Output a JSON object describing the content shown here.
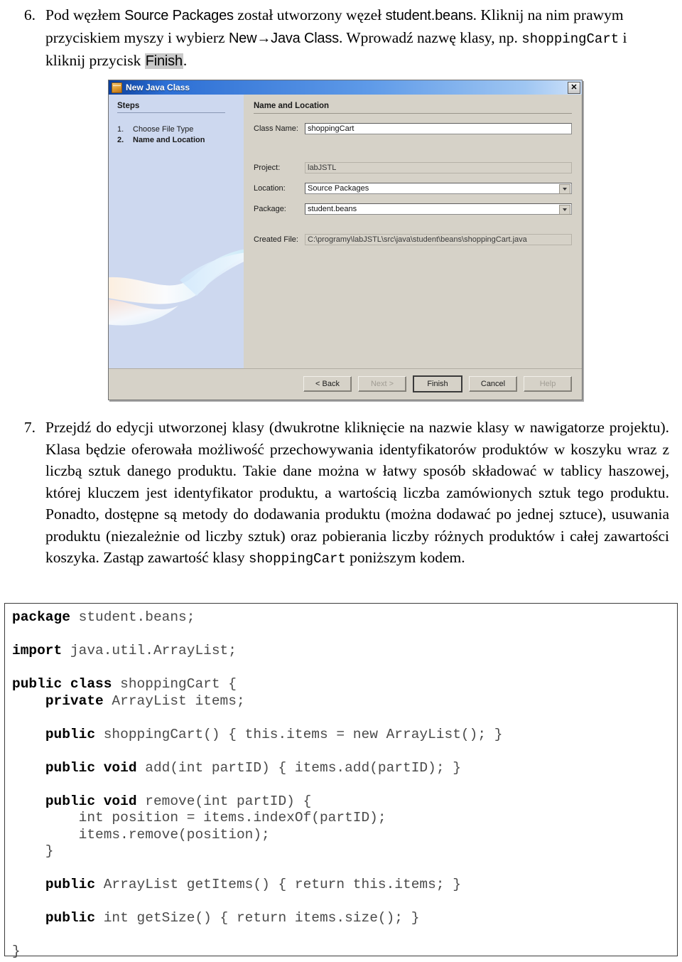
{
  "document": {
    "language": "pl",
    "steps": [
      {
        "number": "6.",
        "segments": [
          {
            "t": "Pod węzłem ",
            "style": "serif"
          },
          {
            "t": "Source Packages",
            "style": "ui-bold"
          },
          {
            "t": " został utworzony węzeł ",
            "style": "serif"
          },
          {
            "t": "student.beans",
            "style": "ui-bold"
          },
          {
            "t": ". Kliknij na nim prawym przyciskiem myszy i wybierz ",
            "style": "serif"
          },
          {
            "t": "New→Java Class",
            "style": "ui-bold"
          },
          {
            "t": ". Wprowadź nazwę klasy, np. ",
            "style": "serif"
          },
          {
            "t": "shoppingCart",
            "style": "mono"
          },
          {
            "t": " i kliknij przycisk ",
            "style": "serif"
          },
          {
            "t": "Finish",
            "style": "ui-highlight"
          },
          {
            "t": ".",
            "style": "serif"
          }
        ],
        "plain": "Pod węzłem Source Packages został utworzony węzeł student.beans. Kliknij na nim prawym przyciskiem myszy i wybierz New→Java Class. Wprowadź nazwę klasy, np. shoppingCart i kliknij przycisk Finish."
      },
      {
        "number": "7.",
        "plain": "Przejdź do edycji utworzonej klasy (dwukrotne kliknięcie na nazwie klasy w nawigatorze projektu). Klasa będzie oferowała możliwość przechowywania identyfikatorów produktów w koszyku wraz z liczbą sztuk danego produktu. Takie dane można w łatwy sposób składować w tablicy haszowej, której kluczem jest identyfikator produktu, a wartością liczba zamówionych sztuk tego produktu. Ponadto, dostępne są metody do dodawania produktu (można dodawać po jednej sztuce), usuwania produktu (niezależnie od liczby sztuk) oraz pobierania liczby różnych produktów i całej zawartości koszyka. Zastąp zawartość klasy shoppingCart poniższym kodem.",
        "parts": {
          "before_code": "Przejdź do edycji utworzonej klasy (dwukrotne kliknięcie na nazwie klasy w nawigatorze projektu). Klasa będzie oferowała możliwość przechowywania identyfikatorów produktów w koszyku wraz z liczbą sztuk danego produktu. Takie dane można w łatwy sposób składować w tablicy haszowej, której kluczem jest identyfikator produktu, a wartością liczba zamówionych sztuk tego produktu. Ponadto, dostępne są metody do dodawania produktu (można dodawać po jednej sztuce), usuwania produktu (niezależnie od liczby sztuk) oraz pobierania liczby różnych produktów i całej zawartości koszyka. Zastąp zawartość klasy ",
          "code_ref": "shoppingCart",
          "after_code": " poniższym kodem."
        }
      }
    ]
  },
  "dialog": {
    "title": "New Java Class",
    "window_icon": "java-class-file-icon",
    "close_label": "✕",
    "steps_heading": "Steps",
    "steps": [
      {
        "num": "1.",
        "label": "Choose File Type",
        "active": false
      },
      {
        "num": "2.",
        "label": "Name and Location",
        "active": true
      }
    ],
    "panel_title": "Name and Location",
    "fields": [
      {
        "key": "class_name",
        "label": "Class Name:",
        "value": "shoppingCart",
        "type": "text",
        "readonly": false
      },
      {
        "key": "project",
        "label": "Project:",
        "value": "labJSTL",
        "type": "text",
        "readonly": true
      },
      {
        "key": "location",
        "label": "Location:",
        "value": "Source Packages",
        "type": "combo",
        "readonly": false
      },
      {
        "key": "package",
        "label": "Package:",
        "value": "student.beans",
        "type": "combo",
        "readonly": false
      },
      {
        "key": "created_file",
        "label": "Created File:",
        "value": "C:\\programy\\labJSTL\\src\\java\\student\\beans\\shoppingCart.java",
        "type": "text",
        "readonly": true
      }
    ],
    "buttons": [
      {
        "label": "< Back",
        "disabled": false,
        "default": false
      },
      {
        "label": "Next >",
        "disabled": true,
        "default": false
      },
      {
        "label": "Finish",
        "disabled": false,
        "default": true
      },
      {
        "label": "Cancel",
        "disabled": false,
        "default": false
      },
      {
        "label": "Help",
        "disabled": true,
        "default": false
      }
    ],
    "colors": {
      "titlebar_start": "#0b3f9c",
      "titlebar_end": "#cfe2fa",
      "dialog_face": "#d6d2c8",
      "steps_pane": "#cdd8ef",
      "field_bg": "#ffffff"
    }
  },
  "code_block": {
    "language": "java",
    "keywords": [
      "package",
      "import",
      "public",
      "class",
      "private",
      "void"
    ],
    "lines": [
      "package student.beans;",
      "",
      "import java.util.ArrayList;",
      "",
      "public class shoppingCart {",
      "    private ArrayList items;",
      "",
      "    public shoppingCart() { this.items = new ArrayList(); }",
      "",
      "    public void add(int partID) { items.add(partID); }",
      "",
      "    public void remove(int partID) {",
      "        int position = items.indexOf(partID);",
      "        items.remove(position);",
      "    }",
      "",
      "    public ArrayList getItems() { return this.items; }",
      "",
      "    public int getSize() { return items.size(); }",
      "",
      "}"
    ],
    "html": "<b>package</b> student.beans;\n\n<b>import</b> java.util.ArrayList;\n\n<b>public class</b> shoppingCart {\n    <b>private</b> ArrayList items;\n\n    <b>public</b> shoppingCart() { this.items = new ArrayList(); }\n\n    <b>public void</b> add(int partID) { items.add(partID); }\n\n    <b>public void</b> remove(int partID) {\n        int position = items.indexOf(partID);\n        items.remove(position);\n    }\n\n    <b>public</b> ArrayList getItems() { return this.items; }\n\n    <b>public</b> int getSize() { return items.size(); }\n\n}"
  }
}
